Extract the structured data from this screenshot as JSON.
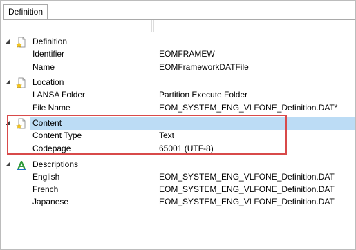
{
  "tab": {
    "label": "Definition"
  },
  "groups": [
    {
      "label": "Definition",
      "icon": "document-star-icon",
      "props": [
        {
          "name": "Identifier",
          "value": "EOMFRAMEW"
        },
        {
          "name": "Name",
          "value": "EOMFrameworkDATFile"
        }
      ]
    },
    {
      "label": "Location",
      "icon": "document-star-icon",
      "props": [
        {
          "name": "LANSA Folder",
          "value": "Partition Execute Folder"
        },
        {
          "name": "File Name",
          "value": "EOM_SYSTEM_ENG_VLFONE_Definition.DAT*"
        }
      ]
    },
    {
      "label": "Content",
      "icon": "document-star-icon",
      "selected": true,
      "props": [
        {
          "name": "Content Type",
          "value": "Text"
        },
        {
          "name": "Codepage",
          "value": "65001 (UTF-8)"
        }
      ]
    },
    {
      "label": "Descriptions",
      "icon": "language-a-icon",
      "props": [
        {
          "name": "English",
          "value": "EOM_SYSTEM_ENG_VLFONE_Definition.DAT"
        },
        {
          "name": "French",
          "value": "EOM_SYSTEM_ENG_VLFONE_Definition.DAT"
        },
        {
          "name": "Japanese",
          "value": "EOM_SYSTEM_ENG_VLFONE_Definition.DAT"
        }
      ]
    }
  ],
  "colors": {
    "selection": "#bcdcf5",
    "highlight": "#d84a4a"
  }
}
